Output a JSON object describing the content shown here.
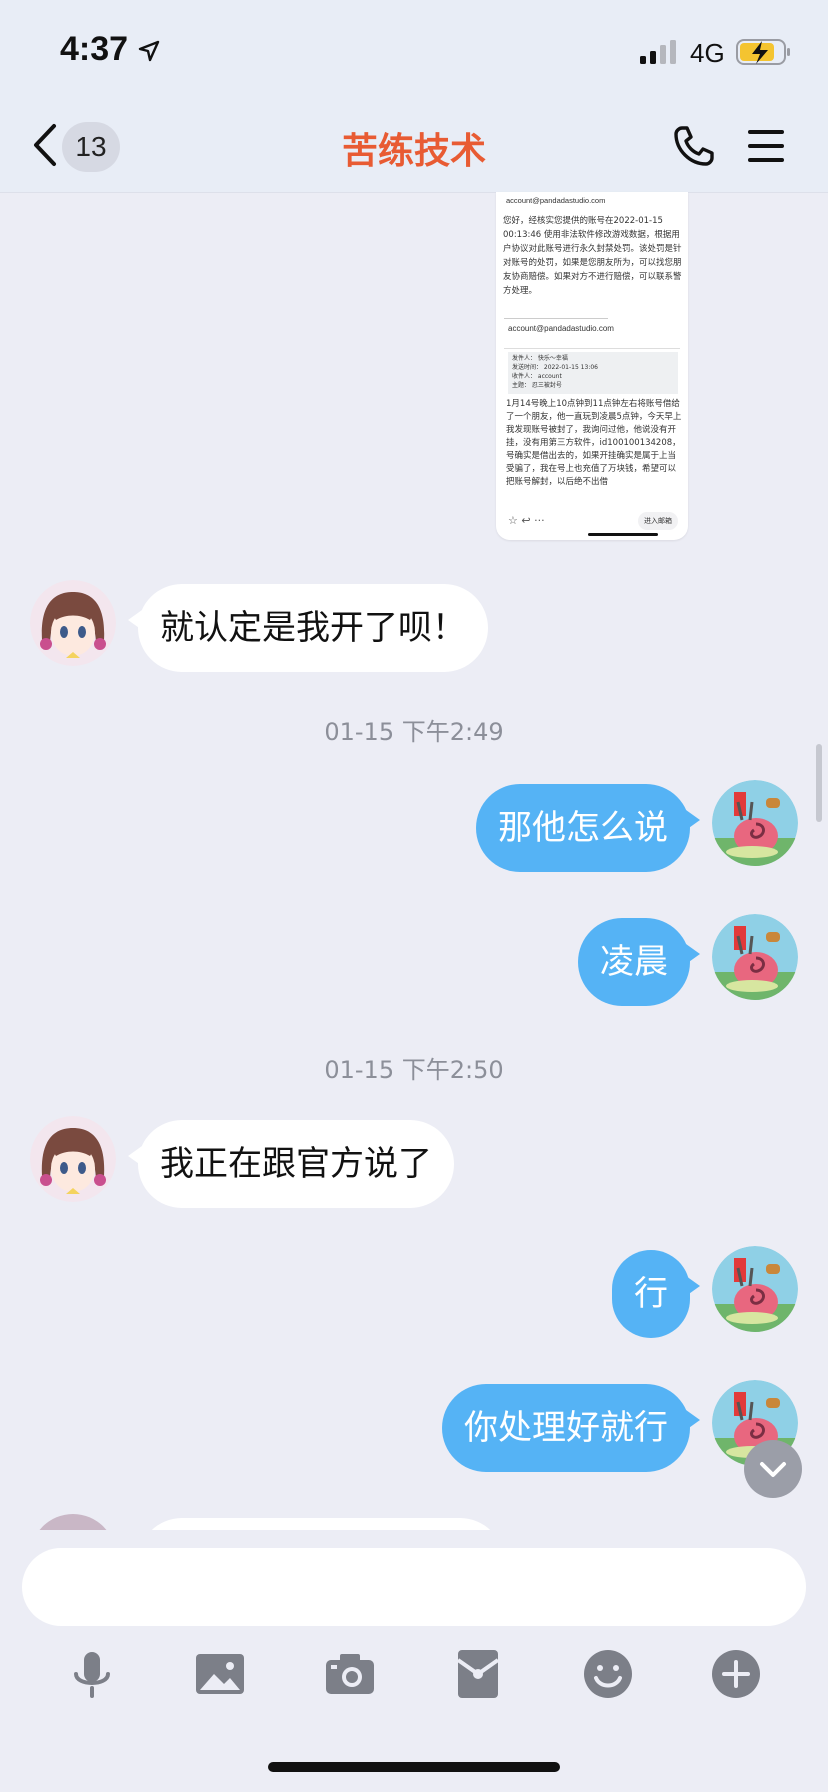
{
  "status_bar": {
    "time": "4:37",
    "network": "4G"
  },
  "header": {
    "back_count": "13",
    "title": "苦练技术"
  },
  "email_screenshot": {
    "from_address": "account@pandadastudio.com",
    "paragraph1": "您好，经核实您提供的账号在2022-01-15 00:13:46 使用非法软件修改游戏数据，根据用户协议对此账号进行永久封禁处罚。该处罚是针对账号的处罚，如果是您朋友所为，可以找您朋友协商赔偿。如果对方不进行赔偿，可以联系警方处理。",
    "address2": "account@pandadastudio.com",
    "meta_lines": [
      "发件人： 快乐～幸福",
      "发送时间： 2022-01-15 13:06",
      "收件人： account",
      "主题： 忍三被封号"
    ],
    "paragraph2": "1月14号晚上10点钟到11点钟左右将账号借给了一个朋友，他一直玩到凌晨5点钟，今天早上我发现账号被封了，我询问过他，他说没有开挂，没有用第三方软件，id100100134208，号确实是借出去的，如果开挂确实是属于上当受骗了，我在号上也充值了万块钱，希望可以把账号解封，以后绝不出借",
    "footer_button": "进入邮箱"
  },
  "messages": [
    {
      "side": "left",
      "text": "就认定是我开了呗！"
    },
    {
      "type": "time",
      "text": "01-15 下午2:49"
    },
    {
      "side": "right",
      "text": "那他怎么说"
    },
    {
      "side": "right",
      "text": "凌晨"
    },
    {
      "type": "time",
      "text": "01-15 下午2:50"
    },
    {
      "side": "left",
      "text": "我正在跟官方说了"
    },
    {
      "side": "right",
      "text": "行"
    },
    {
      "side": "right",
      "text": "你处理好就行"
    }
  ],
  "input": {
    "placeholder": ""
  },
  "toolbar": {
    "icons": [
      "microphone-icon",
      "image-icon",
      "camera-icon",
      "red-packet-icon",
      "emoji-icon",
      "plus-icon"
    ]
  },
  "colors": {
    "title": "#e85b33",
    "right_bubble": "#55b3f5",
    "left_bubble": "#ffffff",
    "background": "#ecedf5"
  }
}
